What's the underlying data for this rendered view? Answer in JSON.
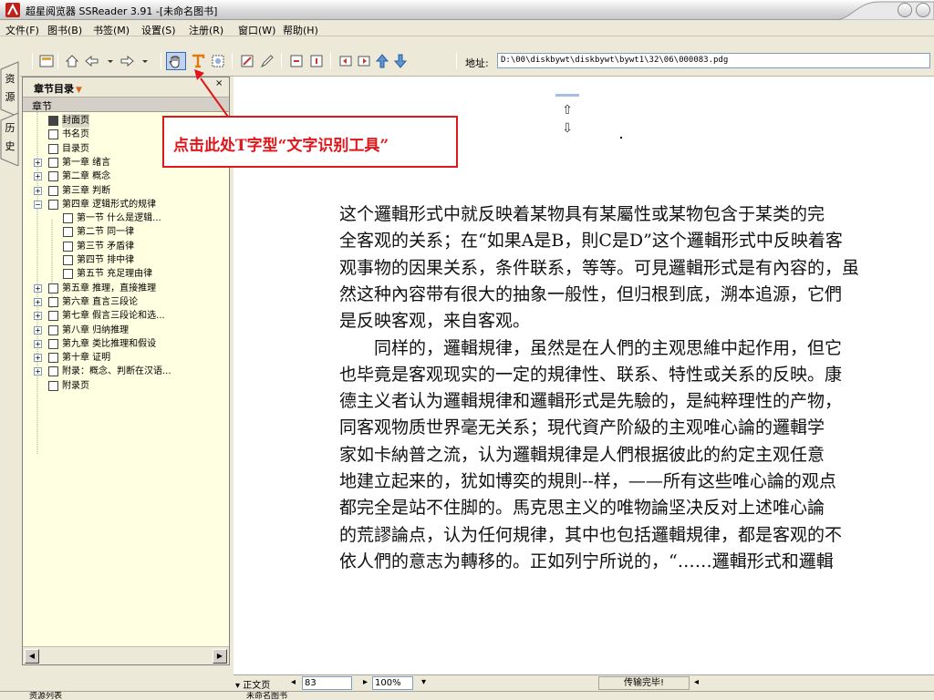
{
  "window": {
    "title": "超星阅览器 SSReader 3.91 -[未命名图书]"
  },
  "menu": [
    "文件(F)",
    "图书(B)",
    "书签(M)",
    "设置(S)",
    "注册(R)",
    "窗口(W)",
    "帮助(H)"
  ],
  "toolbar": {
    "address_label": "地址:",
    "address_value": "D:\\00\\diskbywt\\diskbywt\\bywt1\\32\\06\\000083.pdg"
  },
  "vtabs": [
    "资",
    "源",
    "历",
    "史"
  ],
  "panel": {
    "title": "章节目录",
    "column": "章节",
    "close": "×"
  },
  "tree": [
    {
      "label": "封面页",
      "depth": 0,
      "expander": "",
      "selected": true
    },
    {
      "label": "书名页",
      "depth": 0,
      "expander": ""
    },
    {
      "label": "目录页",
      "depth": 0,
      "expander": ""
    },
    {
      "label": "第一章 绪言",
      "depth": 0,
      "expander": "+"
    },
    {
      "label": "第二章 概念",
      "depth": 0,
      "expander": "+"
    },
    {
      "label": "第三章 判断",
      "depth": 0,
      "expander": "+"
    },
    {
      "label": "第四章 逻辑形式的规律",
      "depth": 0,
      "expander": "−"
    },
    {
      "label": "第一节 什么是逻辑...",
      "depth": 1,
      "expander": ""
    },
    {
      "label": "第二节 同一律",
      "depth": 1,
      "expander": ""
    },
    {
      "label": "第三节 矛盾律",
      "depth": 1,
      "expander": ""
    },
    {
      "label": "第四节 排中律",
      "depth": 1,
      "expander": ""
    },
    {
      "label": "第五节 充足理由律",
      "depth": 1,
      "expander": ""
    },
    {
      "label": "第五章 推理，直接推理",
      "depth": 0,
      "expander": "+"
    },
    {
      "label": "第六章 直言三段论",
      "depth": 0,
      "expander": "+"
    },
    {
      "label": "第七章 假言三段论和选...",
      "depth": 0,
      "expander": "+"
    },
    {
      "label": "第八章 归纳推理",
      "depth": 0,
      "expander": "+"
    },
    {
      "label": "第九章 类比推理和假设",
      "depth": 0,
      "expander": "+"
    },
    {
      "label": "第十章 证明",
      "depth": 0,
      "expander": "+"
    },
    {
      "label": "附录：概念、判断在汉语...",
      "depth": 0,
      "expander": "+"
    },
    {
      "label": "附录页",
      "depth": 0,
      "expander": ""
    }
  ],
  "callout": {
    "text": "点击此处T字型“文字识别工具”"
  },
  "document": {
    "lines": [
      "这个邏輯形式中就反映着某物具有某屬性或某物包含于某类的完",
      "全客观的关系；在“如果A是B，則C是D”这个邏輯形式中反映着客",
      "观事物的因果关系，条件联系，等等。可見邏輯形式是有內容的，虽",
      "然这种內容带有很大的抽象一般性，但归根到底，溯本追源，它們",
      "是反映客观，来自客观。",
      "　　同样的，邏輯規律，虽然是在人們的主观思維中起作用，但它",
      "也毕竟是客观现实的一定的規律性、联系、特性或关系的反映。康",
      "德主义者认为邏輯規律和邏輯形式是先驗的，是純粹理性的产物，",
      "同客观物质世界毫无关系；現代資产阶級的主观唯心論的邏輯学",
      "家如卡納普之流，认为邏輯規律是人們根据彼此的約定主观任意",
      "地建立起来的，犹如博奕的規則--样，——所有这些唯心論的观点",
      "都完全是站不住脚的。馬克思主义的唯物論坚决反对上述唯心論",
      "的荒謬論点，认为任何規律，其中也包括邏輯規律，都是客观的不",
      "依人們的意志为轉移的。正如列宁所说的，“……邏輯形式和邏輯"
    ]
  },
  "status": {
    "mode": "正文页",
    "page": "83",
    "zoom": "100%",
    "message": "传输完毕!"
  },
  "bottom": {
    "left": "资源列表",
    "right": "未命名图书"
  }
}
